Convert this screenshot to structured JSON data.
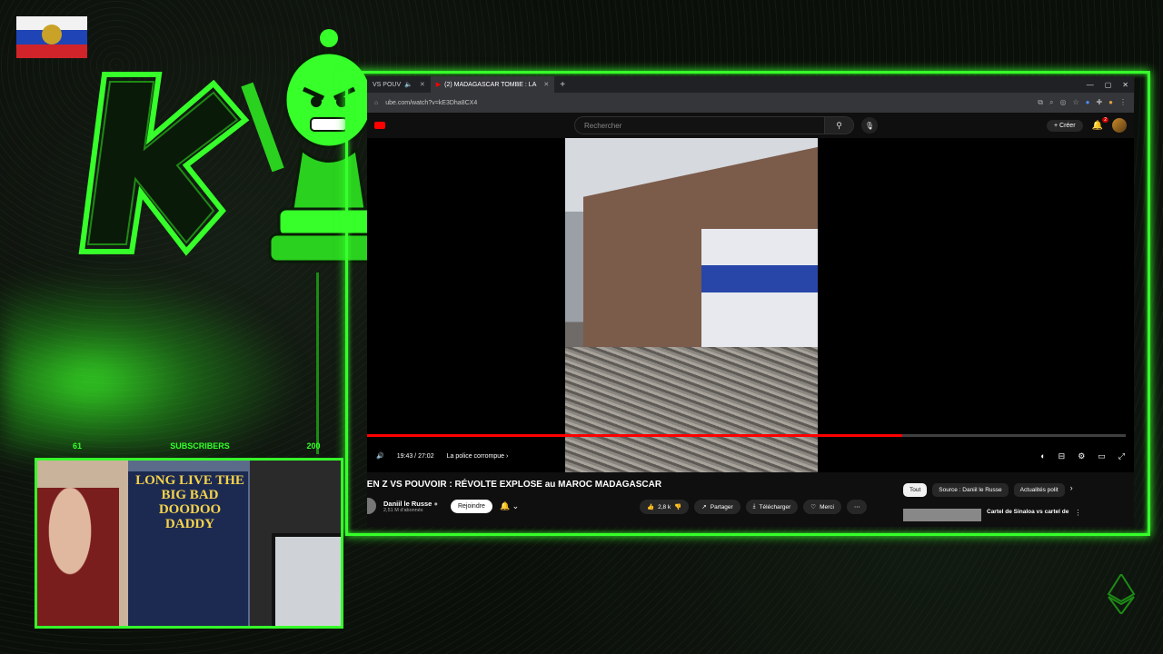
{
  "overlay": {
    "subscribers": {
      "current": "61",
      "label": "SUBSCRIBERS",
      "goal": "200"
    },
    "poster_text": "LONG LIVE THE BIG BAD DOODOO DADDY",
    "colors": {
      "accent": "#36ff2a",
      "background": "#0b0f0a"
    }
  },
  "browser": {
    "tabs": [
      {
        "label": "VS POUV",
        "active": false
      },
      {
        "label": "(2) MADAGASCAR TOMBE : LA",
        "active": true
      }
    ],
    "url": "ube.com/watch?v=kE3Dha8CX4",
    "icons": [
      "home-icon",
      "bookmark-icon",
      "zoom-icon",
      "eye-off-icon",
      "star-icon",
      "extension-icon",
      "profile-icon",
      "menu-icon"
    ]
  },
  "youtube": {
    "search_placeholder": "Rechercher",
    "create_label": "Créer",
    "notification_count": "2",
    "player": {
      "time": "19:43 / 27:02",
      "chapter": "La police corrompue",
      "progress": 0.72
    },
    "video": {
      "title": "GEN Z VS POUVOIR : RÉVOLTE EXPLOSE au MAROC MADAGASCAR",
      "channel": "Daniil le Russe",
      "subscribers": "2,51 M d'abonnés",
      "join_label": "Rejoindre",
      "likes": "2,8 k",
      "share_label": "Partager",
      "download_label": "Télécharger",
      "thanks_label": "Merci"
    },
    "chips": [
      "Tout",
      "Source : Daniil le Russe",
      "Actualités polit"
    ],
    "recommendation": {
      "title": "Cartel de Sinaloa vs cartel de"
    }
  }
}
